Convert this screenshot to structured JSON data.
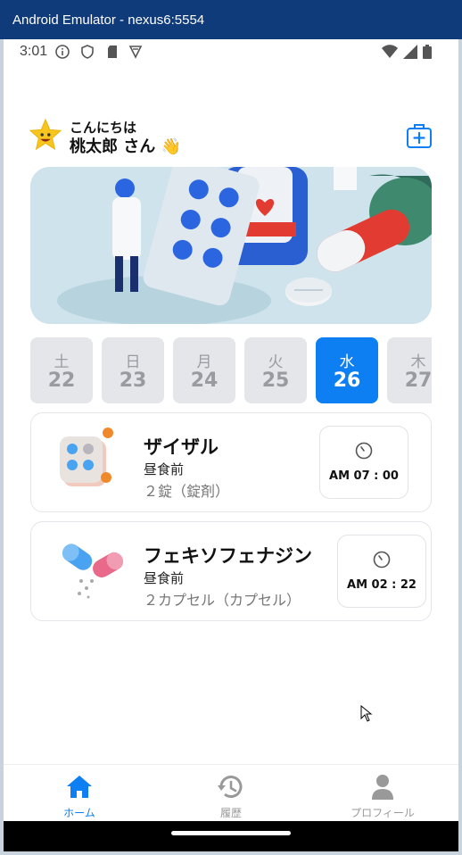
{
  "window": {
    "title": "Android Emulator - nexus6:5554"
  },
  "status_bar": {
    "time": "3:01"
  },
  "header": {
    "greeting": "こんにちは",
    "user_name": "桃太郎 さん 👋"
  },
  "days": [
    {
      "weekday": "土",
      "date": "22",
      "selected": false
    },
    {
      "weekday": "日",
      "date": "23",
      "selected": false
    },
    {
      "weekday": "月",
      "date": "24",
      "selected": false
    },
    {
      "weekday": "火",
      "date": "25",
      "selected": false
    },
    {
      "weekday": "水",
      "date": "26",
      "selected": true
    },
    {
      "weekday": "木",
      "date": "27",
      "selected": false
    }
  ],
  "medications": [
    {
      "name": "ザイザル",
      "timing": "昼食前",
      "dose": "２錠（錠剤）",
      "time": "AM 07 : 00",
      "icon": "pill-blister-icon"
    },
    {
      "name": "フェキソフェナジン",
      "timing": "昼食前",
      "dose": "２カプセル（カプセル）",
      "time": "AM 02 : 22",
      "icon": "capsule-icon"
    }
  ],
  "nav": [
    {
      "label": "ホーム",
      "icon": "home-icon",
      "active": true
    },
    {
      "label": "履歴",
      "icon": "history-icon",
      "active": false
    },
    {
      "label": "プロフィール",
      "icon": "profile-icon",
      "active": false
    }
  ],
  "colors": {
    "accent": "#0d7ff2",
    "title_bar": "#0f3b7a"
  }
}
